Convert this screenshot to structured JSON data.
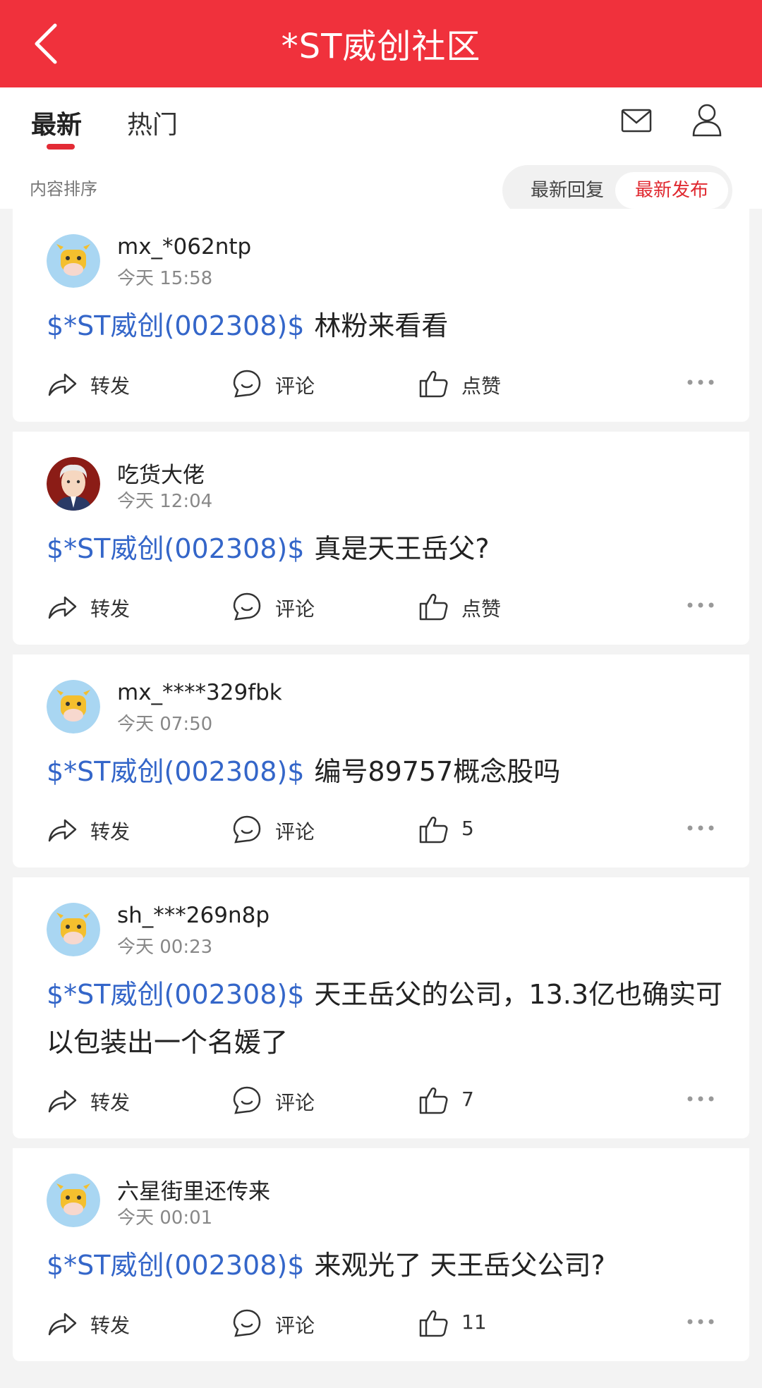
{
  "header": {
    "title": "*ST威创社区"
  },
  "tabs": [
    {
      "label": "最新"
    },
    {
      "label": "热门"
    }
  ],
  "sort": {
    "label": "内容排序",
    "option_reply": "最新回复",
    "option_publish": "最新发布",
    "selected": "最新发布"
  },
  "colors": {
    "header": "#f0313c",
    "accent": "#e32b35",
    "stock_link": "#3466c9"
  },
  "action_labels": {
    "forward": "转发",
    "comment": "评论",
    "like": "点赞"
  },
  "posts": [
    {
      "username": "mx_*062ntp",
      "time": "今天 15:58",
      "avatar": "cow-avatar",
      "stock": "$*ST威创(002308)$",
      "text": "林粉来看看",
      "like_display": "点赞"
    },
    {
      "username": "吃货大佬",
      "time": "今天 12:04",
      "avatar": "cartoon-man-avatar",
      "stock": "$*ST威创(002308)$",
      "text": "真是天王岳父?",
      "like_display": "点赞"
    },
    {
      "username": "mx_****329fbk",
      "time": "今天 07:50",
      "avatar": "cow-avatar",
      "stock": "$*ST威创(002308)$",
      "text": "编号89757概念股吗",
      "like_display": "5"
    },
    {
      "username": "sh_***269n8p",
      "time": "今天 00:23",
      "avatar": "cow-avatar",
      "stock": "$*ST威创(002308)$",
      "text": "天王岳父的公司，13.3亿也确实可以包装出一个名媛了",
      "like_display": "7"
    },
    {
      "username": "六星街里还传来",
      "time": "今天 00:01",
      "avatar": "cow-avatar",
      "stock": "$*ST威创(002308)$",
      "text": "来观光了 天王岳父公司?",
      "like_display": "11"
    }
  ]
}
